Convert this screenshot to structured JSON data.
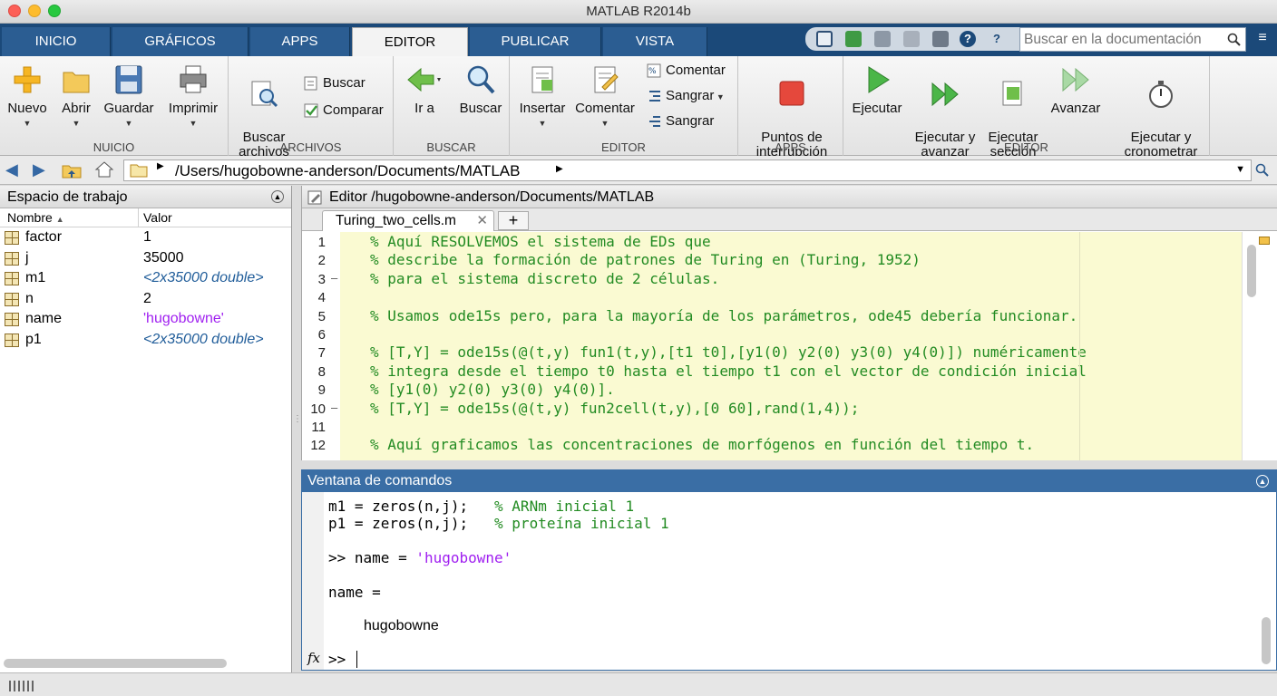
{
  "window": {
    "title": "MATLAB R2014b"
  },
  "tabs": [
    "INICIO",
    "GRÁFICOS",
    "APPS",
    "EDITOR",
    "PUBLICAR",
    "VISTA"
  ],
  "search": {
    "placeholder": "Buscar en la documentación"
  },
  "toolstrip": {
    "groups": {
      "nuevo": "NUICIO",
      "archivos": "ARCHIVOS",
      "buscar": "BUSCAR",
      "editor": "EDITOR",
      "apps": "APPS",
      "ejecutar": "EDITOR"
    },
    "nuevo": "Nuevo",
    "abrir": "Abrir",
    "guardar": "Guardar",
    "imprimir": "Imprimir",
    "buscar_archivos": "Buscar\narchivos",
    "buscar_small": "Buscar",
    "comparar": "Comparar",
    "ir_a": "Ir a",
    "buscar_big": "Buscar",
    "insertar": "Insertar",
    "comentar_big": "Comentar",
    "comentar": "Comentar",
    "sangrar1": "Sangrar",
    "sangrar2": "Sangrar",
    "puntos": "Puntos de\ninterrupción",
    "ejecutar": "Ejecutar",
    "ejecutar_avanzar": "Ejecutar y\navanzar",
    "ejecutar_seccion": "Ejecutar\nsección",
    "avanzar": "Avanzar",
    "cronometrar": "Ejecutar y\ncronometrar"
  },
  "address": {
    "path": "/Users/hugobowne-anderson/Documents/MATLAB"
  },
  "workspace": {
    "title": "Espacio de trabajo",
    "col_name": "Nombre",
    "col_value": "Valor",
    "vars": [
      {
        "name": "factor",
        "value": "1",
        "kind": "plain"
      },
      {
        "name": "j",
        "value": "35000",
        "kind": "plain"
      },
      {
        "name": "m1",
        "value": "<2x35000 double>",
        "kind": "array"
      },
      {
        "name": "n",
        "value": "2",
        "kind": "plain"
      },
      {
        "name": "name",
        "value": "'hugobowne'",
        "kind": "string"
      },
      {
        "name": "p1",
        "value": "<2x35000 double>",
        "kind": "array"
      }
    ]
  },
  "editor": {
    "title": "Editor /hugobowne-anderson/Documents/MATLAB",
    "tab": "Turing_two_cells.m",
    "lines": [
      "% Aquí RESOLVEMOS el sistema de EDs que",
      "% describe la formación de patrones de Turing en (Turing, 1952)",
      "% para el sistema discreto de 2 células.",
      "",
      "% Usamos ode15s pero, para la mayoría de los parámetros, ode45 debería funcionar.",
      "",
      "% [T,Y] = ode15s(@(t,y) fun1(t,y),[t1 t0],[y1(0) y2(0) y3(0) y4(0)]) numéricamente",
      "% integra desde el tiempo t0 hasta el tiempo t1 con el vector de condición inicial",
      "% [y1(0) y2(0) y3(0) y4(0)].",
      "% [T,Y] = ode15s(@(t,y) fun2cell(t,y),[0 60],rand(1,4));",
      "",
      "% Aquí graficamos las concentraciones de morfógenos en función del tiempo t."
    ]
  },
  "command_window": {
    "title": "Ventana de comandos",
    "l1_code": "m1 = zeros(n,j);   ",
    "l1_comment": "% ARNm inicial 1",
    "l2_code": "p1 = zeros(n,j);   ",
    "l2_comment": "% proteína inicial 1",
    "l3_prompt": ">> name = ",
    "l3_str": "'hugobowne'",
    "l4": "name =",
    "l5": "hugobowne",
    "prompt": ">>",
    "fx": "fx"
  }
}
